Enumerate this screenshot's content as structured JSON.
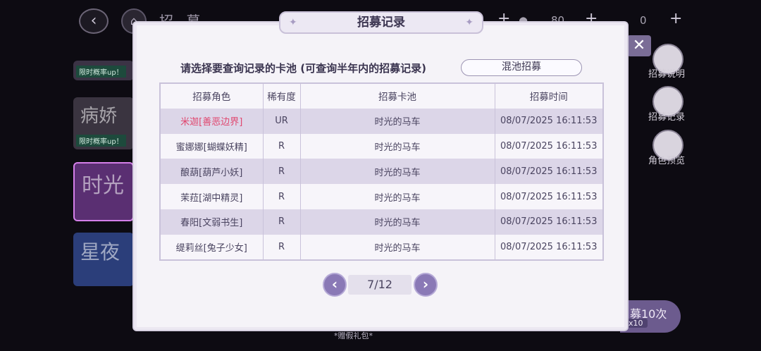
{
  "background": {
    "title": "招 募",
    "currency_values": [
      "80",
      "0"
    ],
    "banners": [
      {
        "tag": "限时概率up！"
      },
      {
        "art_text": "病娇",
        "tag": "限时概率up！"
      },
      {
        "art_text": "时光"
      },
      {
        "art_text": "星夜"
      }
    ],
    "side_menu": [
      "招募说明",
      "招募记录",
      "角色预览"
    ],
    "bottom_button": {
      "label": "募10次",
      "sub": "x10"
    },
    "bottom_gift": "*赠假礼包*"
  },
  "modal": {
    "title": "招募记录",
    "prompt": "请选择要查询记录的卡池 (可查询半年内的招募记录)",
    "pool_select_value": "混池招募",
    "table": {
      "headers": [
        "招募角色",
        "稀有度",
        "招募卡池",
        "招募时间"
      ],
      "rows": [
        {
          "character": "米迦[善恶边界]",
          "rarity": "UR",
          "pool": "时光的马车",
          "time": "08/07/2025 16:11:53"
        },
        {
          "character": "蜜娜娜[蝴蝶妖精]",
          "rarity": "R",
          "pool": "时光的马车",
          "time": "08/07/2025 16:11:53"
        },
        {
          "character": "酿葫[葫芦小妖]",
          "rarity": "R",
          "pool": "时光的马车",
          "time": "08/07/2025 16:11:53"
        },
        {
          "character": "茉菈[湖中精灵]",
          "rarity": "R",
          "pool": "时光的马车",
          "time": "08/07/2025 16:11:53"
        },
        {
          "character": "春阳[文弱书生]",
          "rarity": "R",
          "pool": "时光的马车",
          "time": "08/07/2025 16:11:53"
        },
        {
          "character": "缇莉丝[兔子少女]",
          "rarity": "R",
          "pool": "时光的马车",
          "time": "08/07/2025 16:11:53"
        }
      ]
    },
    "pager": {
      "current": "7/12",
      "prev_icon": "chevron-left-icon",
      "next_icon": "chevron-right-icon"
    }
  },
  "colors": {
    "accent": "#8a79b6",
    "ur_text": "#e0466e",
    "row_highlight": "#dcd6e8"
  }
}
